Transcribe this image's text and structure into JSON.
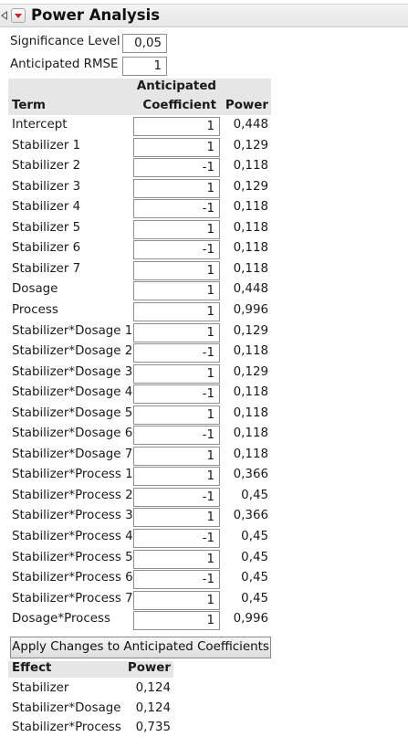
{
  "panel": {
    "title": "Power Analysis",
    "collapse_icon": "disclosure-triangle-icon",
    "menu_icon": "red-triangle-menu-icon"
  },
  "params": {
    "significance_label": "Significance Level",
    "significance_value": "0,05",
    "rmse_label": "Anticipated RMSE",
    "rmse_value": "1"
  },
  "term_table": {
    "headers": {
      "term": "Term",
      "coef_line1": "Anticipated",
      "coef_line2": "Coefficient",
      "power": "Power"
    },
    "rows": [
      {
        "term": "Intercept",
        "coef": "1",
        "power": "0,448"
      },
      {
        "term": "Stabilizer 1",
        "coef": "1",
        "power": "0,129"
      },
      {
        "term": "Stabilizer 2",
        "coef": "-1",
        "power": "0,118"
      },
      {
        "term": "Stabilizer 3",
        "coef": "1",
        "power": "0,129"
      },
      {
        "term": "Stabilizer 4",
        "coef": "-1",
        "power": "0,118"
      },
      {
        "term": "Stabilizer 5",
        "coef": "1",
        "power": "0,118"
      },
      {
        "term": "Stabilizer 6",
        "coef": "-1",
        "power": "0,118"
      },
      {
        "term": "Stabilizer 7",
        "coef": "1",
        "power": "0,118"
      },
      {
        "term": "Dosage",
        "coef": "1",
        "power": "0,448"
      },
      {
        "term": "Process",
        "coef": "1",
        "power": "0,996"
      },
      {
        "term": "Stabilizer*Dosage 1",
        "coef": "1",
        "power": "0,129"
      },
      {
        "term": "Stabilizer*Dosage 2",
        "coef": "-1",
        "power": "0,118"
      },
      {
        "term": "Stabilizer*Dosage 3",
        "coef": "1",
        "power": "0,129"
      },
      {
        "term": "Stabilizer*Dosage 4",
        "coef": "-1",
        "power": "0,118"
      },
      {
        "term": "Stabilizer*Dosage 5",
        "coef": "1",
        "power": "0,118"
      },
      {
        "term": "Stabilizer*Dosage 6",
        "coef": "-1",
        "power": "0,118"
      },
      {
        "term": "Stabilizer*Dosage 7",
        "coef": "1",
        "power": "0,118"
      },
      {
        "term": "Stabilizer*Process 1",
        "coef": "1",
        "power": "0,366"
      },
      {
        "term": "Stabilizer*Process 2",
        "coef": "-1",
        "power": "0,45"
      },
      {
        "term": "Stabilizer*Process 3",
        "coef": "1",
        "power": "0,366"
      },
      {
        "term": "Stabilizer*Process 4",
        "coef": "-1",
        "power": "0,45"
      },
      {
        "term": "Stabilizer*Process 5",
        "coef": "1",
        "power": "0,45"
      },
      {
        "term": "Stabilizer*Process 6",
        "coef": "-1",
        "power": "0,45"
      },
      {
        "term": "Stabilizer*Process 7",
        "coef": "1",
        "power": "0,45"
      },
      {
        "term": "Dosage*Process",
        "coef": "1",
        "power": "0,996"
      }
    ]
  },
  "apply_button_label": "Apply Changes to Anticipated Coefficients",
  "effect_table": {
    "headers": {
      "effect": "Effect",
      "power": "Power"
    },
    "rows": [
      {
        "effect": "Stabilizer",
        "power": "0,124"
      },
      {
        "effect": "Stabilizer*Dosage",
        "power": "0,124"
      },
      {
        "effect": "Stabilizer*Process",
        "power": "0,735"
      }
    ]
  }
}
